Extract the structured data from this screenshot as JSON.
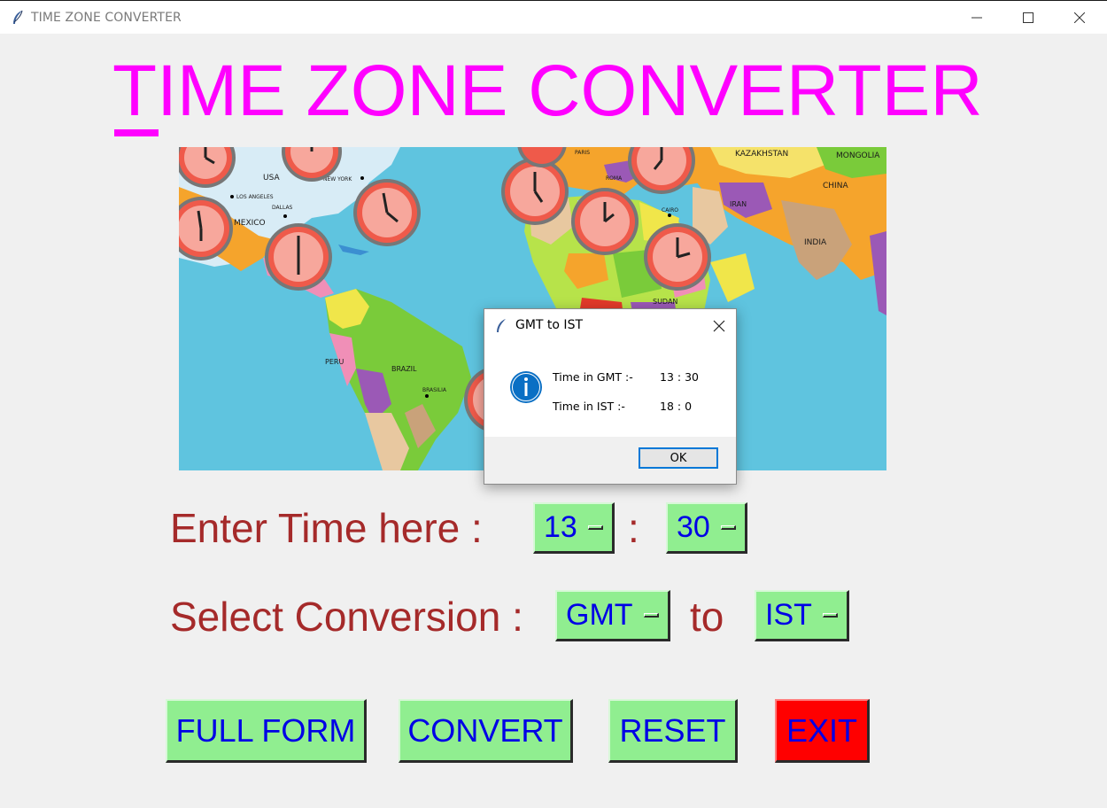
{
  "window": {
    "title": "TIME ZONE CONVERTER"
  },
  "heading": {
    "first_letter": "T",
    "rest": "IME ZONE CONVERTER"
  },
  "map": {
    "labels": [
      "USA",
      "NEW YORK",
      "LOS ANGELES",
      "DALLAS",
      "MEXICO",
      "PERU",
      "BRAZIL",
      "BRASILIA",
      "PARIS",
      "ROMA",
      "CAIRO",
      "SUDAN",
      "KAZAKHSTAN",
      "MONGOLIA",
      "CHINA",
      "IRAN",
      "INDIA",
      "CHINA"
    ]
  },
  "form": {
    "enter_time_label": "Enter Time here :",
    "hour_value": "13",
    "colon": ":",
    "minute_value": "30",
    "select_conversion_label": "Select Conversion :",
    "from_zone": "GMT",
    "to_label": "to",
    "to_zone": "IST"
  },
  "buttons": {
    "full_form": "FULL FORM",
    "convert": "CONVERT",
    "reset": "RESET",
    "exit": "EXIT"
  },
  "dialog": {
    "title": "GMT to IST",
    "gmt_label": "Time in GMT :-",
    "gmt_value": "13  :  30",
    "ist_label": "Time in IST :-",
    "ist_value": "18  :  0",
    "ok_label": "OK"
  },
  "colors": {
    "heading": "#ff00ff",
    "label": "#a52a2a",
    "button_green": "#90ee90",
    "button_text": "#0000e6",
    "exit_red": "#ff0000",
    "ocean": "#5fc4df"
  }
}
